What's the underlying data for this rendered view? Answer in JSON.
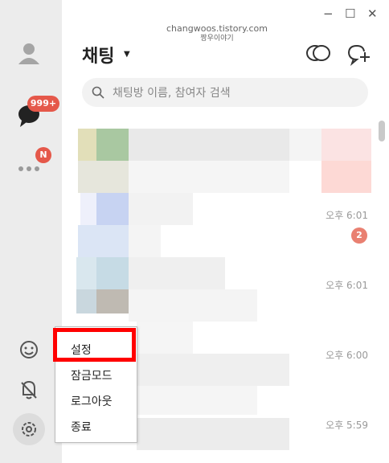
{
  "window": {
    "minimize": "−",
    "maximize": "☐",
    "close": "✕"
  },
  "watermark": {
    "line1": "changwoos.tistory.com",
    "line2": "짱우이야기"
  },
  "header": {
    "title": "채팅",
    "dropdown_arrow": "▼"
  },
  "search": {
    "placeholder": "채팅방 이름, 참여자 검색"
  },
  "sidebar": {
    "chats_badge": "999+",
    "more_badge": "N",
    "items": [
      "profile-icon",
      "chat-bubble-icon",
      "more-dots-icon",
      "emoji-icon",
      "bell-off-icon",
      "gear-icon"
    ]
  },
  "chat_list": {
    "times": [
      "오후 6:01",
      "오후 6:01",
      "오후 6:00",
      "오후 5:59"
    ],
    "unread": "2"
  },
  "context_menu": {
    "items": [
      "설정",
      "잠금모드",
      "로그아웃",
      "종료"
    ]
  },
  "colors": {
    "badge": "#e5584a",
    "highlight": "#ff0000"
  }
}
